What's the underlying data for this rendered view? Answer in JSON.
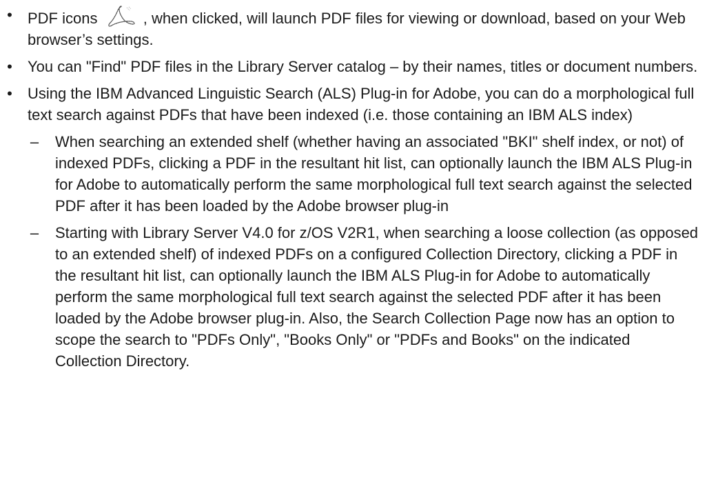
{
  "bullets": [
    {
      "lead": "PDF icons",
      "icon": "adobe-pdf-icon",
      "text": ", when clicked, will launch PDF files for viewing or download, based on your Web browser’s settings."
    },
    {
      "text": "You can \"Find\" PDF files in the Library Server catalog – by their names, titles or document numbers."
    },
    {
      "text": "Using the IBM Advanced Linguistic Search (ALS) Plug-in for Adobe, you can do a morphological full text search against PDFs that have been indexed (i.e. those containing an IBM ALS index)",
      "sub": [
        {
          "text": "When searching an extended shelf (whether having an associated \"BKI\" shelf index, or not) of indexed PDFs, clicking a PDF in the resultant hit list, can optionally launch the IBM ALS Plug-in for Adobe to automatically perform the same morphological full text search against the selected PDF after it has been loaded by the Adobe browser plug-in"
        },
        {
          "text": "Starting with Library Server V4.0 for z/OS V2R1, when searching a loose collection (as opposed to an extended shelf) of indexed PDFs on a configured Collection Directory, clicking a PDF in the resultant hit list, can optionally launch the IBM ALS Plug-in for Adobe to automatically perform the same morphological full text search against the selected PDF after it has been loaded by the Adobe browser plug-in. Also, the Search Collection Page now has an option to scope the search to \"PDFs Only\", \"Books Only\" or \"PDFs and Books\" on the indicated Collection Directory."
        }
      ]
    }
  ],
  "markers": {
    "bullet": "•",
    "dash": "–"
  }
}
